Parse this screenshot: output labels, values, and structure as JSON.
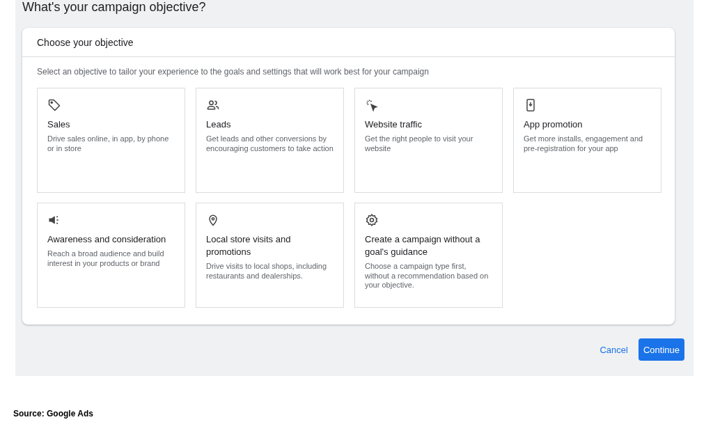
{
  "page_title": "What's your campaign objective?",
  "card": {
    "title": "Choose your objective",
    "intro": "Select an objective to tailor your experience to the goals and settings that will work best for your campaign",
    "objectives": [
      {
        "kind": "tag",
        "title": "Sales",
        "description": "Drive sales online, in app, by phone or in store"
      },
      {
        "kind": "people",
        "title": "Leads",
        "description": "Get leads and other conversions by encouraging customers to take action"
      },
      {
        "kind": "click",
        "title": "Website traffic",
        "description": "Get the right people to visit your website"
      },
      {
        "kind": "phone",
        "title": "App promotion",
        "description": "Get more installs, engagement and pre-registration for your app"
      },
      {
        "kind": "megaphone",
        "title": "Awareness and consideration",
        "description": "Reach a broad audience and build interest in your products or brand"
      },
      {
        "kind": "pin",
        "title": "Local store visits and promotions",
        "description": "Drive visits to local shops, including restaurants and dealerships."
      },
      {
        "kind": "gear",
        "title": "Create a campaign without a goal's guidance",
        "description": "Choose a campaign type first, without a recommendation based on your objective."
      }
    ]
  },
  "buttons": {
    "cancel": "Cancel",
    "continue": "Continue"
  },
  "source": "Source: Google Ads"
}
